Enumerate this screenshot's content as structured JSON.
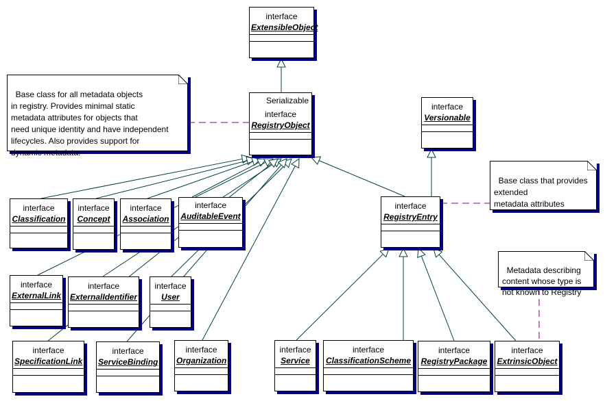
{
  "diagram": {
    "type": "uml-class-diagram",
    "colors": {
      "generalization_line": "#004040",
      "note_link": "#800080",
      "shadow": "#000080"
    },
    "classes": [
      {
        "id": "ExtensibleObject",
        "stereotype": "interface",
        "name": "ExtensibleObject"
      },
      {
        "id": "RegistryObject",
        "stereotype": "interface",
        "extra": "Serializable",
        "name": "RegistryObject"
      },
      {
        "id": "Versionable",
        "stereotype": "interface",
        "name": "Versionable"
      },
      {
        "id": "Classification",
        "stereotype": "interface",
        "name": "Classification"
      },
      {
        "id": "Concept",
        "stereotype": "interface",
        "name": "Concept"
      },
      {
        "id": "Association",
        "stereotype": "interface",
        "name": "Association"
      },
      {
        "id": "AuditableEvent",
        "stereotype": "interface",
        "name": "AuditableEvent"
      },
      {
        "id": "RegistryEntry",
        "stereotype": "interface",
        "name": "RegistryEntry"
      },
      {
        "id": "ExternalLink",
        "stereotype": "interface",
        "name": "ExternalLink"
      },
      {
        "id": "ExternalIdentifier",
        "stereotype": "interface",
        "name": "ExternalIdentifier"
      },
      {
        "id": "User",
        "stereotype": "interface",
        "name": "User"
      },
      {
        "id": "SpecificationLink",
        "stereotype": "interface",
        "name": "SpecificationLink"
      },
      {
        "id": "ServiceBinding",
        "stereotype": "interface",
        "name": "ServiceBinding"
      },
      {
        "id": "Organization",
        "stereotype": "interface",
        "name": "Organization"
      },
      {
        "id": "Service",
        "stereotype": "interface",
        "name": "Service"
      },
      {
        "id": "ClassificationScheme",
        "stereotype": "interface",
        "name": "ClassificationScheme"
      },
      {
        "id": "RegistryPackage",
        "stereotype": "interface",
        "name": "RegistryPackage"
      },
      {
        "id": "ExtrinsicObject",
        "stereotype": "interface",
        "name": "ExtrinsicObject"
      }
    ],
    "notes": [
      {
        "id": "note-registry-object",
        "text": "Base class for all metadata objects\nin registry. Provides minimal static\nmetadata attributes for objects that\nneed unique identity and have independent\nlifecycles. Also provides support for\ndynamic metadata.",
        "attached_to": "RegistryObject"
      },
      {
        "id": "note-registry-entry",
        "text": "Base class that provides\nextended\nmetadata attributes",
        "attached_to": "RegistryEntry"
      },
      {
        "id": "note-extrinsic-object",
        "text": "Metadata describing\ncontent whose type is\nnot known to Registry",
        "attached_to": "ExtrinsicObject"
      }
    ],
    "generalizations": [
      {
        "from": "RegistryObject",
        "to": "ExtensibleObject"
      },
      {
        "from": "RegistryEntry",
        "to": "Versionable"
      },
      {
        "from": "Classification",
        "to": "RegistryObject"
      },
      {
        "from": "Concept",
        "to": "RegistryObject"
      },
      {
        "from": "Association",
        "to": "RegistryObject"
      },
      {
        "from": "AuditableEvent",
        "to": "RegistryObject"
      },
      {
        "from": "ExternalLink",
        "to": "RegistryObject"
      },
      {
        "from": "ExternalIdentifier",
        "to": "RegistryObject"
      },
      {
        "from": "User",
        "to": "RegistryObject"
      },
      {
        "from": "SpecificationLink",
        "to": "RegistryObject"
      },
      {
        "from": "ServiceBinding",
        "to": "RegistryObject"
      },
      {
        "from": "Organization",
        "to": "RegistryObject"
      },
      {
        "from": "RegistryEntry",
        "to": "RegistryObject"
      },
      {
        "from": "Service",
        "to": "RegistryEntry"
      },
      {
        "from": "ClassificationScheme",
        "to": "RegistryEntry"
      },
      {
        "from": "RegistryPackage",
        "to": "RegistryEntry"
      },
      {
        "from": "ExtrinsicObject",
        "to": "RegistryEntry"
      }
    ]
  }
}
